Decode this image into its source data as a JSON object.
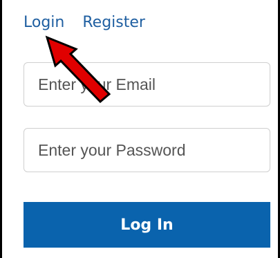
{
  "tabs": {
    "login": "Login",
    "register": "Register"
  },
  "form": {
    "email_placeholder": "Enter your Email",
    "password_placeholder": "Enter your Password",
    "submit_label": "Log In"
  },
  "annotation": {
    "arrow_icon": "red-arrow-icon",
    "arrow_color": "#e00000"
  },
  "colors": {
    "link": "#1f5fa1",
    "button": "#0a63ad"
  }
}
